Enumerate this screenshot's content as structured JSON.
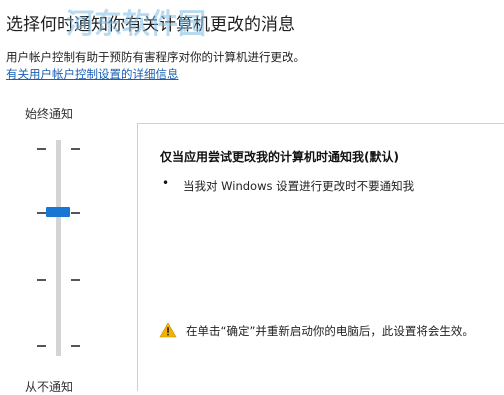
{
  "header": {
    "title": "选择何时通知你有关计算机更改的消息",
    "description": "用户帐户控制有助于预防有害程序对你的计算机进行更改。",
    "link": "有关用户帐户控制设置的详细信息"
  },
  "watermark": "河东软件园",
  "slider": {
    "top_label": "始终通知",
    "bottom_label": "从不通知",
    "level": 3,
    "levels": 4
  },
  "panel": {
    "heading": "仅当应用尝试更改我的计算机时通知我(默认)",
    "bullet_symbol": "•",
    "bullet_text": "当我对 Windows 设置进行更改时不要通知我",
    "warning_text": "在单击“确定”并重新启动你的电脑后，此设置将会生效。",
    "warning_icon": "warning-icon"
  },
  "colors": {
    "accent": "#1976d2",
    "link": "#1a5fb4",
    "warning": "#f0b400"
  }
}
